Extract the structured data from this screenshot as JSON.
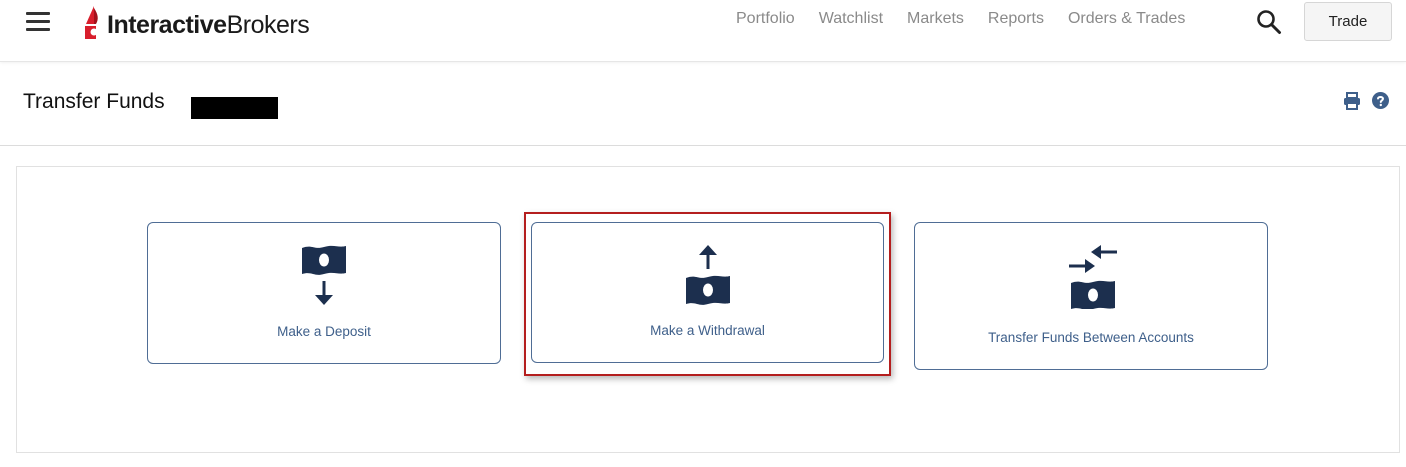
{
  "header": {
    "logo_text_bold": "Interactive",
    "logo_text_regular": "Brokers",
    "nav": [
      "Portfolio",
      "Watchlist",
      "Markets",
      "Reports",
      "Orders & Trades"
    ],
    "trade_label": "Trade"
  },
  "page": {
    "title": "Transfer Funds"
  },
  "cards": {
    "deposit": "Make a Deposit",
    "withdrawal": "Make a Withdrawal",
    "transfer": "Transfer Funds Between Accounts"
  },
  "colors": {
    "accent": "#1c2f4e",
    "card_border": "#4f6d95",
    "card_text": "#3e5f8a",
    "highlight": "#b41e1e",
    "logo_red": "#d81e2c"
  },
  "icons": [
    "menu-icon",
    "search-icon",
    "print-icon",
    "help-icon",
    "money-down-icon",
    "money-up-icon",
    "transfer-arrows-icon"
  ]
}
